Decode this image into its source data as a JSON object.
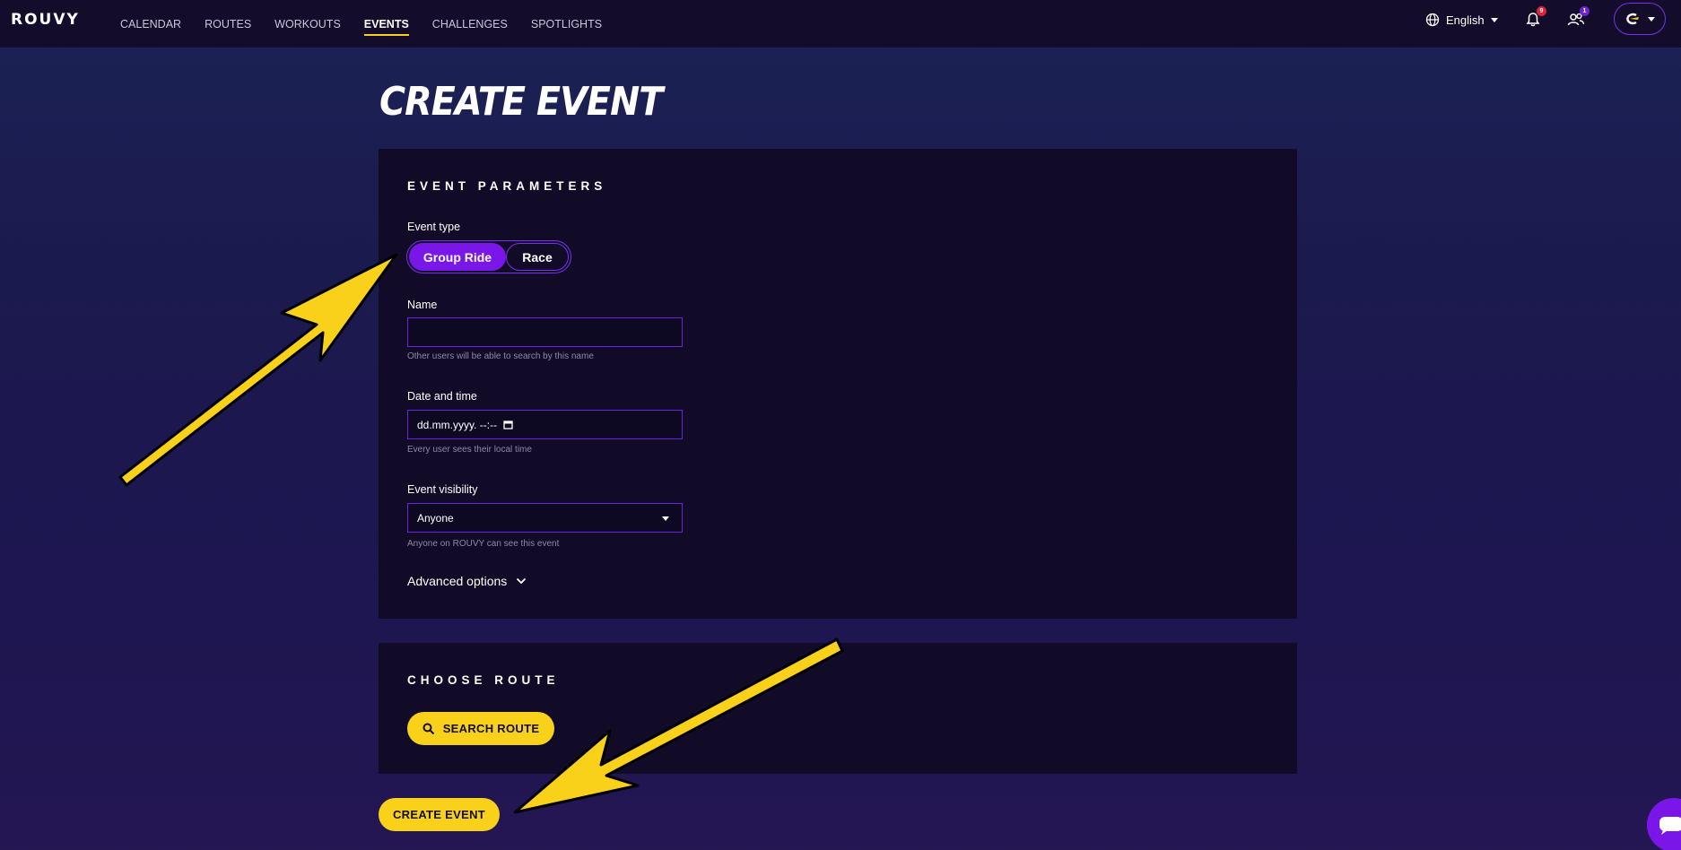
{
  "app": {
    "logo_text": "ROUVY"
  },
  "nav": {
    "items": [
      {
        "label": "CALENDAR"
      },
      {
        "label": "ROUTES"
      },
      {
        "label": "WORKOUTS"
      },
      {
        "label": "EVENTS"
      },
      {
        "label": "CHALLENGES"
      },
      {
        "label": "SPOTLIGHTS"
      }
    ],
    "active": "EVENTS"
  },
  "header": {
    "language": "English",
    "notifications_count": "9",
    "friends_count": "1"
  },
  "page": {
    "title": "CREATE EVENT"
  },
  "params": {
    "section_title": "EVENT PARAMETERS",
    "event_type_label": "Event type",
    "event_types": [
      "Group Ride",
      "Race"
    ],
    "selected_event_type": "Group Ride",
    "name_label": "Name",
    "name_value": "",
    "name_hint": "Other users will be able to search by this name",
    "date_label": "Date and time",
    "date_placeholder": "dd.mm.yyyy. --:--",
    "date_hint": "Every user sees their local time",
    "visibility_label": "Event visibility",
    "visibility_value": "Anyone",
    "visibility_hint": "Anyone on ROUVY can see this event",
    "advanced_label": "Advanced options"
  },
  "route": {
    "section_title": "CHOOSE ROUTE",
    "search_label": "SEARCH ROUTE"
  },
  "actions": {
    "create_label": "CREATE EVENT"
  },
  "colors": {
    "accent_yellow": "#f9d11a",
    "accent_purple": "#7a16e8",
    "card_bg": "#110b28",
    "nav_bg": "#130d2b"
  },
  "icons": [
    "globe-icon",
    "bell-icon",
    "friends-icon",
    "search-icon",
    "chevron-down-icon",
    "calendar-icon",
    "chat-icon"
  ]
}
